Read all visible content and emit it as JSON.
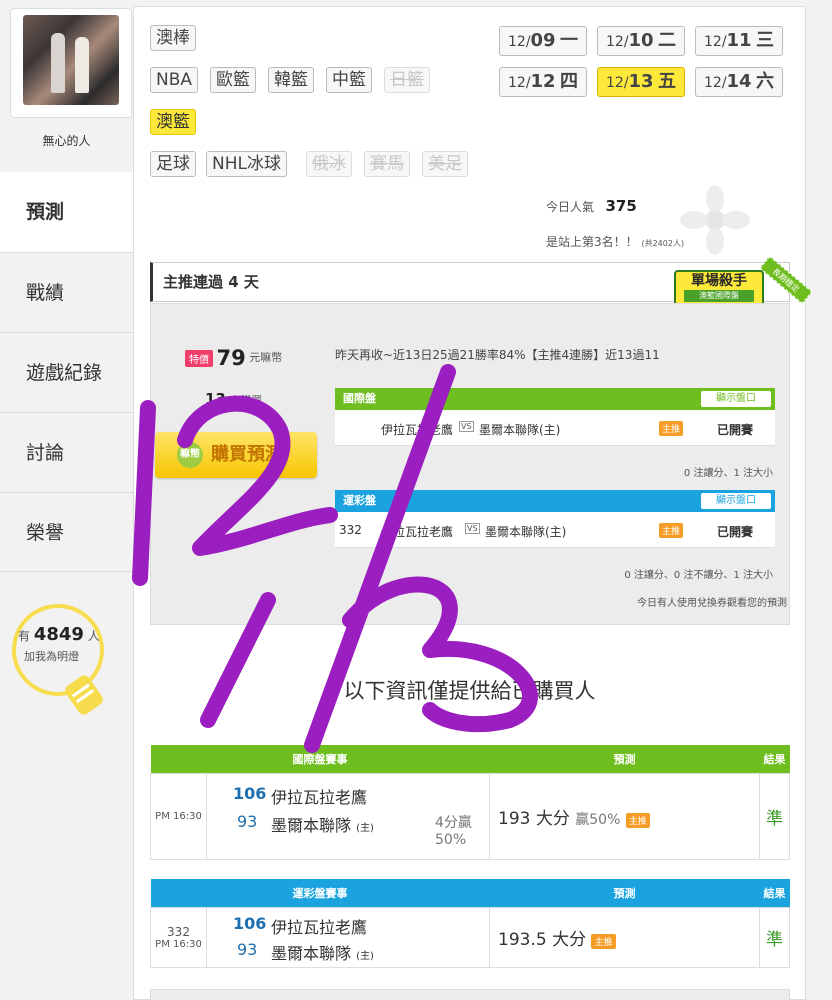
{
  "sidebar": {
    "username": "無心的人",
    "nav": [
      "預測",
      "戰績",
      "遊戲紀錄",
      "討論",
      "榮譽"
    ],
    "fans": {
      "prefix": "有",
      "count": "4849",
      "suffix": "人",
      "action": "加我為明燈"
    }
  },
  "leagues": {
    "row1": [
      "澳棒"
    ],
    "row2": [
      "NBA",
      "歐籃",
      "韓籃",
      "中籃",
      "日籃"
    ],
    "row3": [
      "澳籃"
    ],
    "row4": [
      "足球",
      "NHL冰球",
      "俄冰",
      "賽馬",
      "美足"
    ]
  },
  "dates": [
    {
      "md": "12/",
      "d": "09",
      "wd": "一"
    },
    {
      "md": "12/",
      "d": "10",
      "wd": "二"
    },
    {
      "md": "12/",
      "d": "11",
      "wd": "三"
    },
    {
      "md": "12/",
      "d": "12",
      "wd": "四"
    },
    {
      "md": "12/",
      "d": "13",
      "wd": "五"
    },
    {
      "md": "12/",
      "d": "14",
      "wd": "六"
    }
  ],
  "popularity": {
    "label": "今日人氣",
    "value": "375",
    "rank": "是站上第3名！！",
    "total": "(共2402人)"
  },
  "section": {
    "title": "主推連過 4 天",
    "badge": "單場殺手",
    "badge_sub": "澳籃國際盤",
    "ribbon": "長期穩定"
  },
  "purchase": {
    "special": "特價",
    "price": "79",
    "price_unit": "元嘛幣",
    "buyers": "13",
    "buyers_unit": "人購買",
    "buy_label": "購買預測",
    "buy_icon": "嘛幣",
    "summary": "昨天再收~近13日25過21勝率84%【主推4連勝】近13過11"
  },
  "markets": [
    {
      "name": "國際盤",
      "show": "顯示盤口",
      "code": "",
      "away": "伊拉瓦拉老鷹",
      "home": "墨爾本聯隊(主)",
      "tag": "主推",
      "status": "已開賽",
      "note": "0 注讓分、1 注大小"
    },
    {
      "name": "運彩盤",
      "show": "顯示盤口",
      "code": "332",
      "away": "伊拉瓦拉老鷹",
      "home": "墨爾本聯隊(主)",
      "tag": "主推",
      "status": "已開賽",
      "note": "0 注讓分、0 注不讓分、1 注大小"
    }
  ],
  "vs_label": "VS",
  "redeem_note": "今日有人使用兌換券觀看您的預測",
  "info_only": "以下資訊僅提供給已購買人",
  "results": [
    {
      "header_game": "國際盤賽事",
      "header_pred": "預測",
      "header_res": "結果",
      "code": "",
      "time": "PM 16:30",
      "away_score": "106",
      "away": "伊拉瓦拉老鷹",
      "home_score": "93",
      "home": "墨爾本聯隊",
      "home_tag": "(主)",
      "margin1": "4分贏",
      "margin2": "50%",
      "pred": "193 大分",
      "pred_extra": "贏50%",
      "tag": "主推",
      "result": "準"
    },
    {
      "header_game": "運彩盤賽事",
      "header_pred": "預測",
      "header_res": "結果",
      "code": "332",
      "time": "PM 16:30",
      "away_score": "106",
      "away": "伊拉瓦拉老鷹",
      "home_score": "93",
      "home": "墨爾本聯隊",
      "home_tag": "(主)",
      "margin1": "",
      "margin2": "",
      "pred": "193.5 大分",
      "pred_extra": "",
      "tag": "主推",
      "result": "準"
    }
  ],
  "handwriting": "12/13",
  "colors": {
    "accent_yellow": "#fde93a",
    "green": "#6fbe1f",
    "blue": "#1aa3de",
    "orange": "#f59d27",
    "doodle": "#9b1fc0",
    "win": "#3a9a25"
  }
}
